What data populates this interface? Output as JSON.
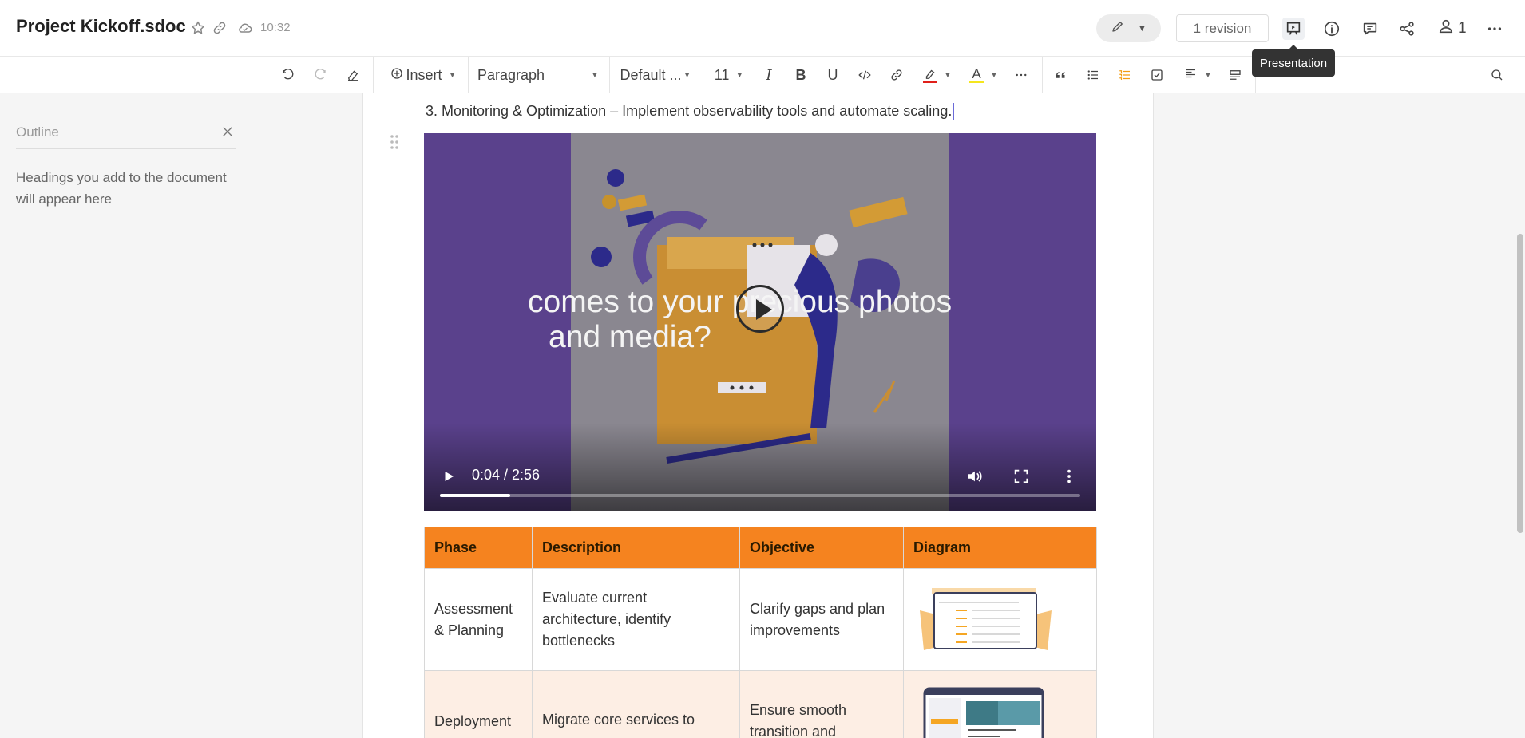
{
  "header": {
    "title": "Project Kickoff.sdoc",
    "save_time": "10:32",
    "revision_label": "1 revision",
    "collaborator_count": "1",
    "tooltip": "Presentation"
  },
  "toolbar": {
    "insert_label": "Insert",
    "paragraph_label": "Paragraph",
    "font_label": "Default ...",
    "font_size": "11",
    "highlight_color": "#e0201a",
    "text_color": "#f5e61e"
  },
  "outline": {
    "title": "Outline",
    "hint": "Headings you add to the document will appear here"
  },
  "document": {
    "text_line": "3. Monitoring & Optimization – Implement observability tools and automate scaling.",
    "video": {
      "caption_line1": "comes to your precious photos",
      "caption_line2": "and media?",
      "time": "0:04 / 2:56",
      "progress": 0.11
    },
    "table": {
      "headers": [
        "Phase",
        "Description",
        "Objective",
        "Diagram"
      ],
      "rows": [
        {
          "phase": "Assessment & Planning",
          "description": "Evaluate current architecture, identify bottlenecks",
          "objective": "Clarify gaps and plan improvements"
        },
        {
          "phase": "Deployment",
          "description": "Migrate core services to",
          "objective": "Ensure smooth transition and"
        }
      ]
    }
  },
  "colors": {
    "accent_orange": "#f5831f",
    "row_alt": "#fdeee4",
    "video_purple": "#5a418c"
  }
}
